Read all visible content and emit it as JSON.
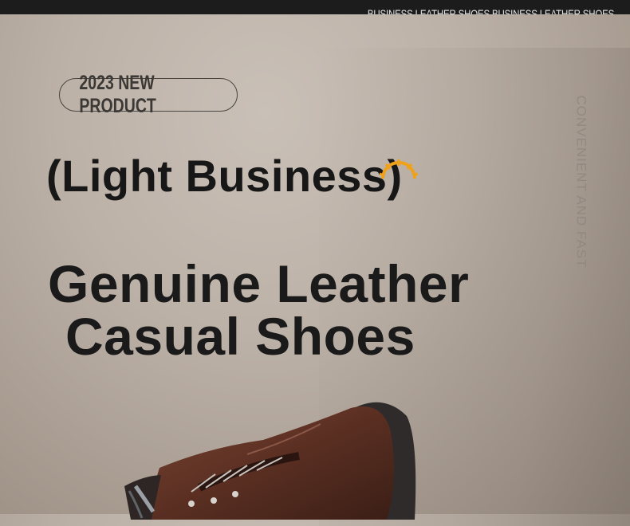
{
  "header": {
    "marquee_text": "BUSINESS LEATHER SHOES  BUSINESS LEATHER SHOES"
  },
  "badge": {
    "label": "2023 NEW PRODUCT"
  },
  "side_caption": "CONVENIENT AND FAST",
  "subtitle": "(Light Business)",
  "title": {
    "line1": "Genuine Leather",
    "line2": "Casual Shoes"
  },
  "icons": {
    "sun": "sun-icon",
    "product": "leather-shoe-image"
  },
  "colors": {
    "background": "#bcb1a7",
    "top_bar": "#1c1c1c",
    "headline": "#1a1a1a",
    "accent_sun": "#f0a11a",
    "shoe_leather": "#5a2f22"
  }
}
